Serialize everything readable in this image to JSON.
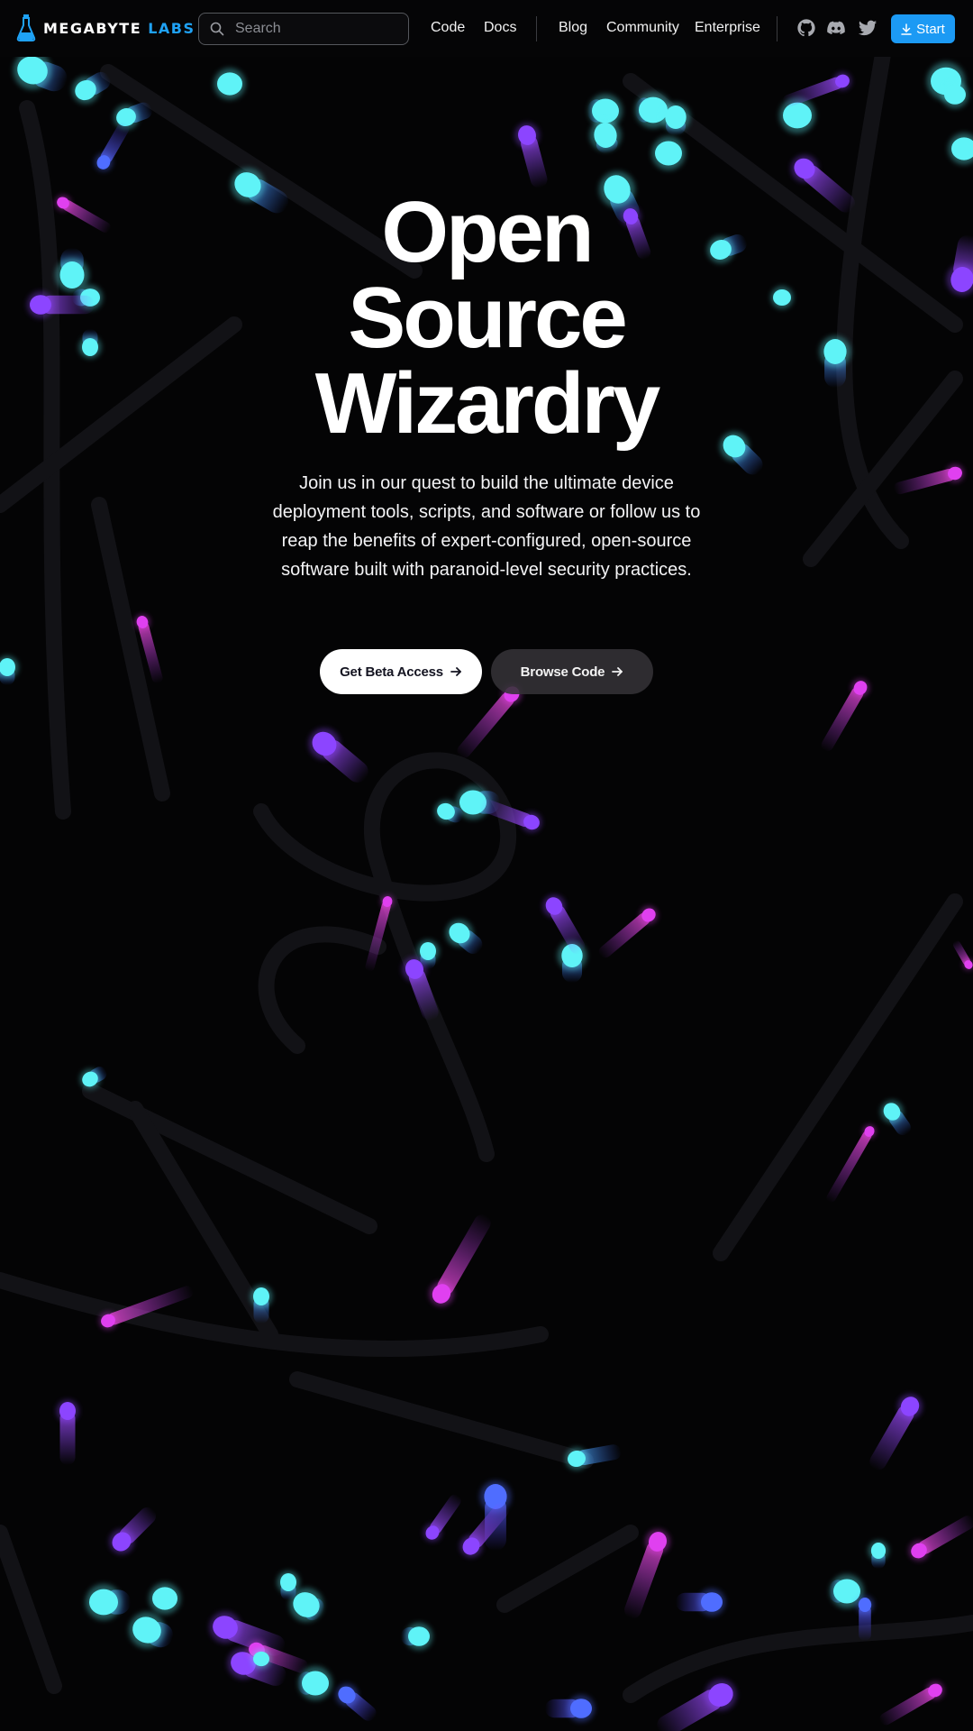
{
  "brand": {
    "word1": "MEGABYTE",
    "word2": "LABS"
  },
  "search": {
    "placeholder": "Search"
  },
  "nav": {
    "links": [
      "Code",
      "Docs",
      "Blog",
      "Community",
      "Enterprise"
    ],
    "social_icons": [
      "github-icon",
      "discord-icon",
      "twitter-icon"
    ],
    "start_label": "Start"
  },
  "hero": {
    "title_lines": [
      "Open",
      "Source",
      "Wizardry"
    ],
    "subtitle": "Join us in our quest to build the ultimate device deployment tools, scripts, and software or follow us to reap the benefits of expert-configured, open-source software built with paranoid-level security practices.",
    "primary_button": "Get Beta Access",
    "secondary_button": "Browse Code"
  },
  "colors": {
    "background": "#040405",
    "accent": "#1c9af4",
    "particle_cyan": "#5ff3f7",
    "particle_blue": "#4f6dff",
    "particle_purple": "#8c45ff",
    "particle_magenta": "#e040f0"
  }
}
